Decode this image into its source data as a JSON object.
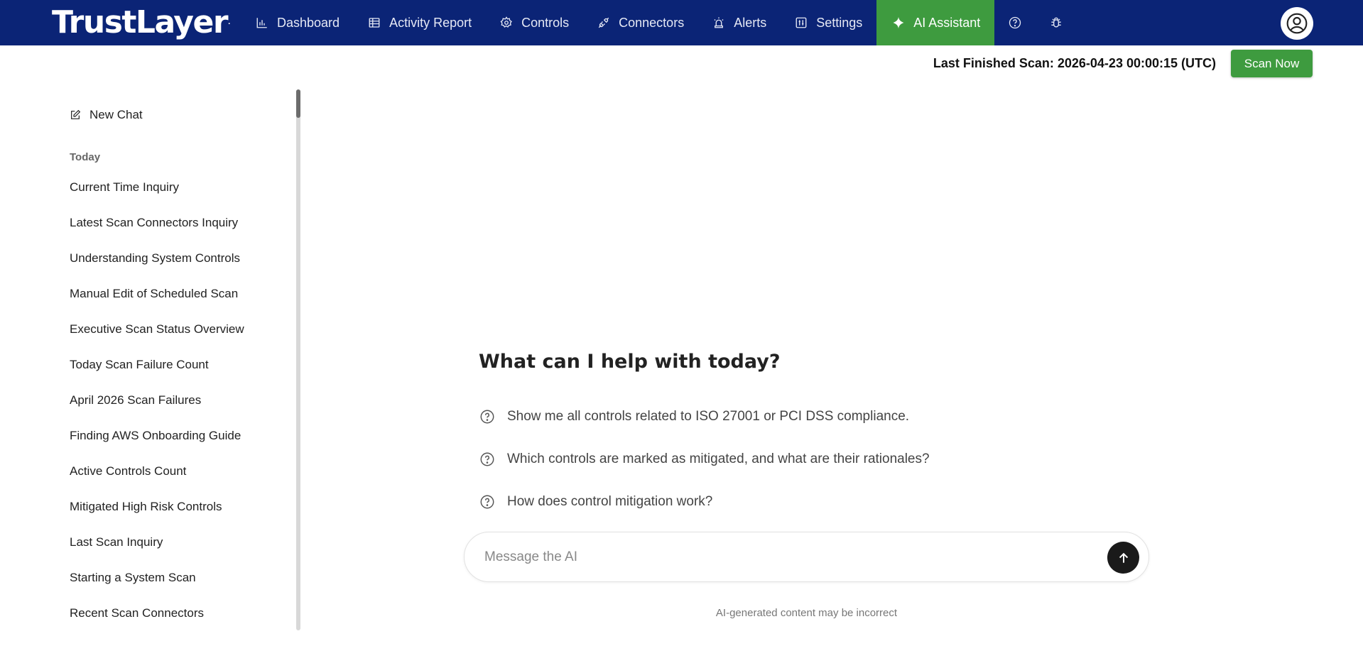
{
  "navbar": {
    "logo": "TrustLayer",
    "logo_mark": ".",
    "items": [
      {
        "label": "Dashboard",
        "icon": "bar-chart-icon"
      },
      {
        "label": "Activity Report",
        "icon": "table-icon"
      },
      {
        "label": "Controls",
        "icon": "gear-icon"
      },
      {
        "label": "Connectors",
        "icon": "plug-icon"
      },
      {
        "label": "Alerts",
        "icon": "siren-icon"
      },
      {
        "label": "Settings",
        "icon": "sliders-icon"
      },
      {
        "label": "AI Assistant",
        "icon": "sparkle-icon",
        "active": true
      }
    ],
    "icon_buttons": [
      "help-circle-icon",
      "bug-icon"
    ],
    "avatar_icon": "user-circle-icon",
    "active_color": "#3e9b3f",
    "bar_color": "#0b2476"
  },
  "scan": {
    "status": "Last Finished Scan: 2026-04-23 00:00:15 (UTC)",
    "button_label": "Scan Now"
  },
  "sidebar": {
    "new_chat_label": "New Chat",
    "section_label": "Today",
    "history": [
      "Current Time Inquiry",
      "Latest Scan Connectors Inquiry",
      "Understanding System Controls",
      "Manual Edit of Scheduled Scan",
      "Executive Scan Status Overview",
      "Today Scan Failure Count",
      "April 2026 Scan Failures",
      "Finding AWS Onboarding Guide",
      "Active Controls Count",
      "Mitigated High Risk Controls",
      "Last Scan Inquiry",
      "Starting a System Scan",
      "Recent Scan Connectors"
    ]
  },
  "chat": {
    "heading": "What can I help with today?",
    "suggestions": [
      "Show me all controls related to ISO 27001 or PCI DSS compliance.",
      "Which controls are marked as mitigated, and what are their rationales?",
      "How does control mitigation work?"
    ],
    "input_placeholder": "Message the AI",
    "input_value": "",
    "disclaimer": "AI-generated content may be incorrect"
  }
}
